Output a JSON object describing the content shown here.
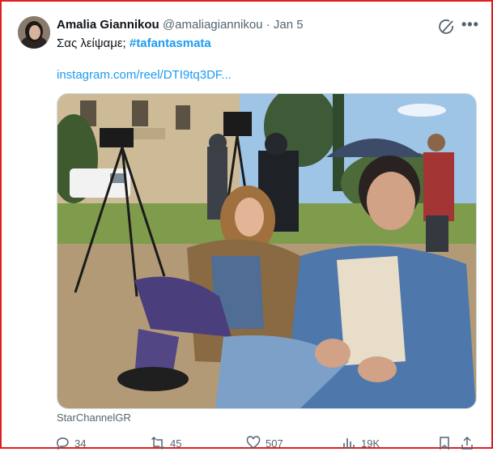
{
  "tweet": {
    "author_name": "Amalia Giannikou",
    "handle": "@amaliagiannikou",
    "separator": "·",
    "date": "Jan 5",
    "text": "Σας λείψαμε; ",
    "hashtag": "#tafantasmata",
    "link": "instagram.com/reel/DTI9tq3DF...",
    "media_source": "StarChannelGR"
  },
  "icons": {
    "grok": "grok-icon",
    "more": "more-icon",
    "reply": "reply-icon",
    "retweet": "retweet-icon",
    "like": "like-icon",
    "views": "views-icon",
    "bookmark": "bookmark-icon",
    "share": "share-icon"
  },
  "actions": {
    "replies": "34",
    "retweets": "45",
    "likes": "507",
    "views": "19K"
  },
  "colors": {
    "accent": "#1d9bf0",
    "text": "#0f1419",
    "muted": "#536471"
  }
}
